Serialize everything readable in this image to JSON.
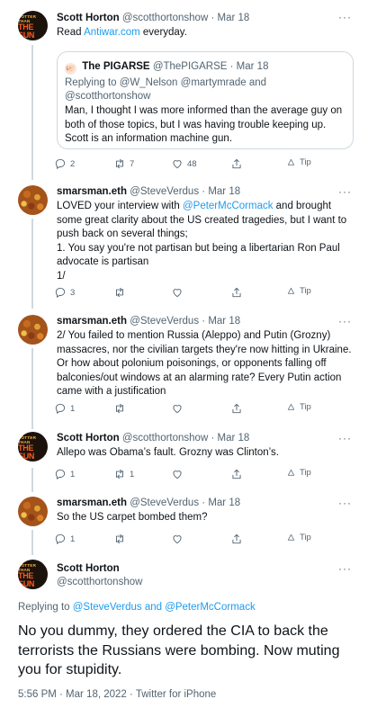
{
  "tweets": [
    {
      "name": "Scott Horton",
      "handle": "@scotthortonshow",
      "time": "Mar 18",
      "avatar": "hotter-than-the-sun",
      "text_prefix": "Read ",
      "text_link": "Antiwar.com",
      "text_suffix": " everyday.",
      "quote": {
        "emoji": "🐖",
        "name": "The PIGARSE",
        "handle": "@ThePIGARSE",
        "time": "Mar 18",
        "reply_to": "Replying to @W_Nelson @martymrade and @scotthortonshow",
        "text": "Man, I thought I was more informed than the average guy on both of those topics, but I was having trouble keeping up. Scott is an information machine gun."
      },
      "replies": "2",
      "retweets": "7",
      "likes": "48",
      "tip": "Tip"
    },
    {
      "name": "smarsman.eth",
      "handle": "@SteveVerdus",
      "time": "Mar 18",
      "avatar": "corn",
      "text_prefix": "LOVED your interview with ",
      "text_link": "@PeterMcCormack",
      "text_suffix": " and brought some great clarity about the US created tragedies, but I want to push back on several things;\n1. You say you're not partisan but being a libertarian Ron Paul advocate is partisan\n1/",
      "replies": "3",
      "retweets": "",
      "likes": "",
      "tip": "Tip"
    },
    {
      "name": "smarsman.eth",
      "handle": "@SteveVerdus",
      "time": "Mar 18",
      "avatar": "corn",
      "text": "2/ You failed to mention Russia (Aleppo) and Putin (Grozny) massacres, nor the civilian targets they're now hitting in Ukraine. Or how about polonium poisonings, or opponents falling off balconies/out windows at an alarming rate? Every Putin action came with a justification",
      "replies": "1",
      "retweets": "",
      "likes": "",
      "tip": "Tip"
    },
    {
      "name": "Scott Horton",
      "handle": "@scotthortonshow",
      "time": "Mar 18",
      "avatar": "hotter-than-the-sun",
      "text": "Allepo was Obama’s fault. Grozny was Clinton’s.",
      "replies": "1",
      "retweets": "1",
      "likes": "",
      "tip": "Tip"
    },
    {
      "name": "smarsman.eth",
      "handle": "@SteveVerdus",
      "time": "Mar 18",
      "avatar": "corn",
      "text": "So the US carpet bombed them?",
      "replies": "1",
      "retweets": "",
      "likes": "",
      "tip": "Tip"
    }
  ],
  "avatar_text": {
    "line1": "HOTTER THAN",
    "line2": "THE SUN"
  },
  "main": {
    "name": "Scott Horton",
    "handle": "@scotthortonshow",
    "reply_label": "Replying to ",
    "reply_users": "@SteveVerdus and @PeterMcCormack",
    "text": "No you dummy, they ordered the CIA to back the terrorists the Russians were bombing. Now muting you for stupidity.",
    "timestamp": "5:56 PM · Mar 18, 2022 · Twitter for iPhone"
  },
  "more_label": "···",
  "colors": {
    "link": "#1d9bf0",
    "secondary": "#536471",
    "border": "#cfd9de"
  }
}
